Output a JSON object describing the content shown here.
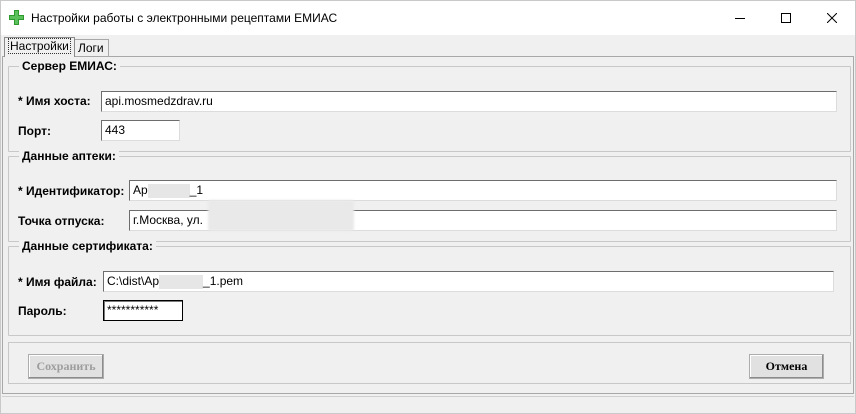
{
  "window": {
    "title": "Настройки работы с электронными рецептами ЕМИАС",
    "icon": "green-cross-icon",
    "accent_color": "#2e9a2e"
  },
  "tabs": [
    {
      "label": "Настройки",
      "active": true
    },
    {
      "label": "Логи",
      "active": false
    }
  ],
  "server": {
    "title": "Сервер ЕМИАС:",
    "host_label": "* Имя хоста:",
    "host_value": "api.mosmedzdrav.ru",
    "port_label": "Порт:",
    "port_value": "443"
  },
  "pharmacy": {
    "title": "Данные аптеки:",
    "id_label": "* Идентификатор:",
    "id_value_prefix": "Ap",
    "id_value_suffix": "_1",
    "point_label": "Точка отпуска:",
    "point_value": "г.Москва, ул."
  },
  "certificate": {
    "title": "Данные сертификата:",
    "file_label": "* Имя файла:",
    "file_value_prefix": "C:\\dist\\Ap",
    "file_value_suffix": "_1.pem",
    "password_label": "Пароль:",
    "password_value": "***********"
  },
  "buttons": {
    "save": "Сохранить",
    "cancel": "Отмена"
  }
}
